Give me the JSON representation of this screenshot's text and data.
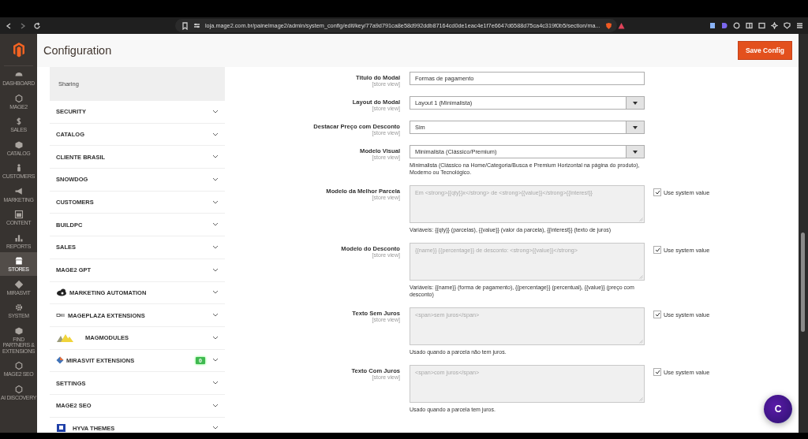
{
  "browser": {
    "url": "loja.mage2.com.br/painelmage2/admin/system_config/edit/key/77a9d791ca8e58d992ddb87164cd0de1eac4e1f7e6647d6588d75ca4c319f0b5/section/ma..."
  },
  "nav": {
    "items": [
      {
        "label": "DASHBOARD",
        "selected": false
      },
      {
        "label": "MAGE2",
        "selected": false
      },
      {
        "label": "SALES",
        "selected": false
      },
      {
        "label": "CATALOG",
        "selected": false
      },
      {
        "label": "CUSTOMERS",
        "selected": false
      },
      {
        "label": "MARKETING",
        "selected": false
      },
      {
        "label": "CONTENT",
        "selected": false
      },
      {
        "label": "REPORTS",
        "selected": false
      },
      {
        "label": "STORES",
        "selected": true
      },
      {
        "label": "MIRASVIT",
        "selected": false
      },
      {
        "label": "SYSTEM",
        "selected": false
      },
      {
        "label": "FIND PARTNERS & EXTENSIONS",
        "selected": false
      },
      {
        "label": "MAGE2 SEO",
        "selected": false
      },
      {
        "label": "AI DISCOVERY",
        "selected": false
      }
    ]
  },
  "header": {
    "title": "Configuration",
    "save_button": "Save Config"
  },
  "sections": {
    "current": "Sharing",
    "items": [
      {
        "label": "SECURITY"
      },
      {
        "label": "CATALOG"
      },
      {
        "label": "CLIENTE BRASIL"
      },
      {
        "label": "SNOWDOG"
      },
      {
        "label": "CUSTOMERS"
      },
      {
        "label": "BUILDPC"
      },
      {
        "label": "SALES"
      },
      {
        "label": "MAGE2 GPT"
      },
      {
        "label": "MARKETING AUTOMATION"
      },
      {
        "label": "MAGEPLAZA EXTENSIONS"
      },
      {
        "label": "MAGMODULES"
      },
      {
        "label": "MIRASVIT EXTENSIONS",
        "badge": "0"
      },
      {
        "label": "SETTINGS"
      },
      {
        "label": "MAGE2 SEO"
      },
      {
        "label": "HYVA THEMES"
      }
    ]
  },
  "form": {
    "fields": [
      {
        "kind": "text",
        "label": "Titulo do Modal",
        "scope": "[store view]",
        "value": "Formas de pagamento"
      },
      {
        "kind": "select",
        "label": "Layout do Modal",
        "scope": "[store view]",
        "value": "Layout 1 (Minimalista)"
      },
      {
        "kind": "select",
        "label": "Destacar Preço com Desconto",
        "scope": "[store view]",
        "value": "Sim"
      },
      {
        "kind": "select",
        "label": "Modelo Visual",
        "scope": "[store view]",
        "value": "Minimalista (Clássico/Premium)",
        "note": "Minimalista (Clássico na Home/Categoria/Busca e Premium Horizontal na página do produto), Moderno ou Tecnológico."
      },
      {
        "kind": "textarea",
        "label": "Modelo da Melhor Parcela",
        "scope": "[store view]",
        "value": "Em <strong>{{qty}}x</strong> de <strong>{{value}}</strong>{{interest}}",
        "use_system_value": true,
        "system_label": "Use system value",
        "note": "Variáveis: {{qty}} (parcelas), {{value}} (valor da parcela), {{interest}} (texto de juros)"
      },
      {
        "kind": "textarea",
        "label": "Modelo do Desconto",
        "scope": "[store view]",
        "value": "{{name}} {{percentage}} de desconto: <strong>{{value}}</strong>",
        "use_system_value": true,
        "system_label": "Use system value",
        "note": "Variáveis: {{name}} (forma de pagamento), {{percentage}} (percentual), {{value}} (preço com desconto)"
      },
      {
        "kind": "textarea",
        "label": "Texto Sem Juros",
        "scope": "[store view]",
        "value": "<span>sem juros</span>",
        "use_system_value": true,
        "system_label": "Use system value",
        "note": "Usado quando a parcela não tem juros."
      },
      {
        "kind": "textarea",
        "label": "Texto Com Juros",
        "scope": "[store view]",
        "value": "<span>com juros</span>",
        "use_system_value": true,
        "system_label": "Use system value",
        "note": "Usado quando a parcela tem juros."
      }
    ]
  },
  "chat_button": {
    "label": "C"
  }
}
